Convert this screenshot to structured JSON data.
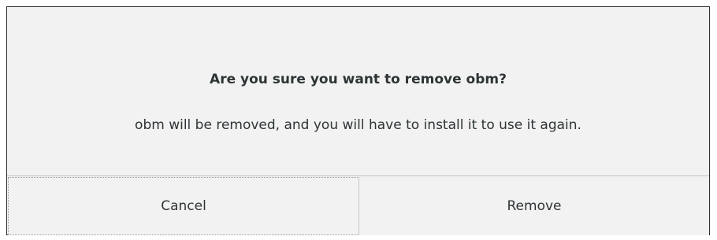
{
  "dialog": {
    "title": "Are you sure you want to remove obm?",
    "message": "obm will be removed, and you will have to install it to use it again.",
    "buttons": {
      "cancel_label": "Cancel",
      "remove_label": "Remove"
    }
  }
}
